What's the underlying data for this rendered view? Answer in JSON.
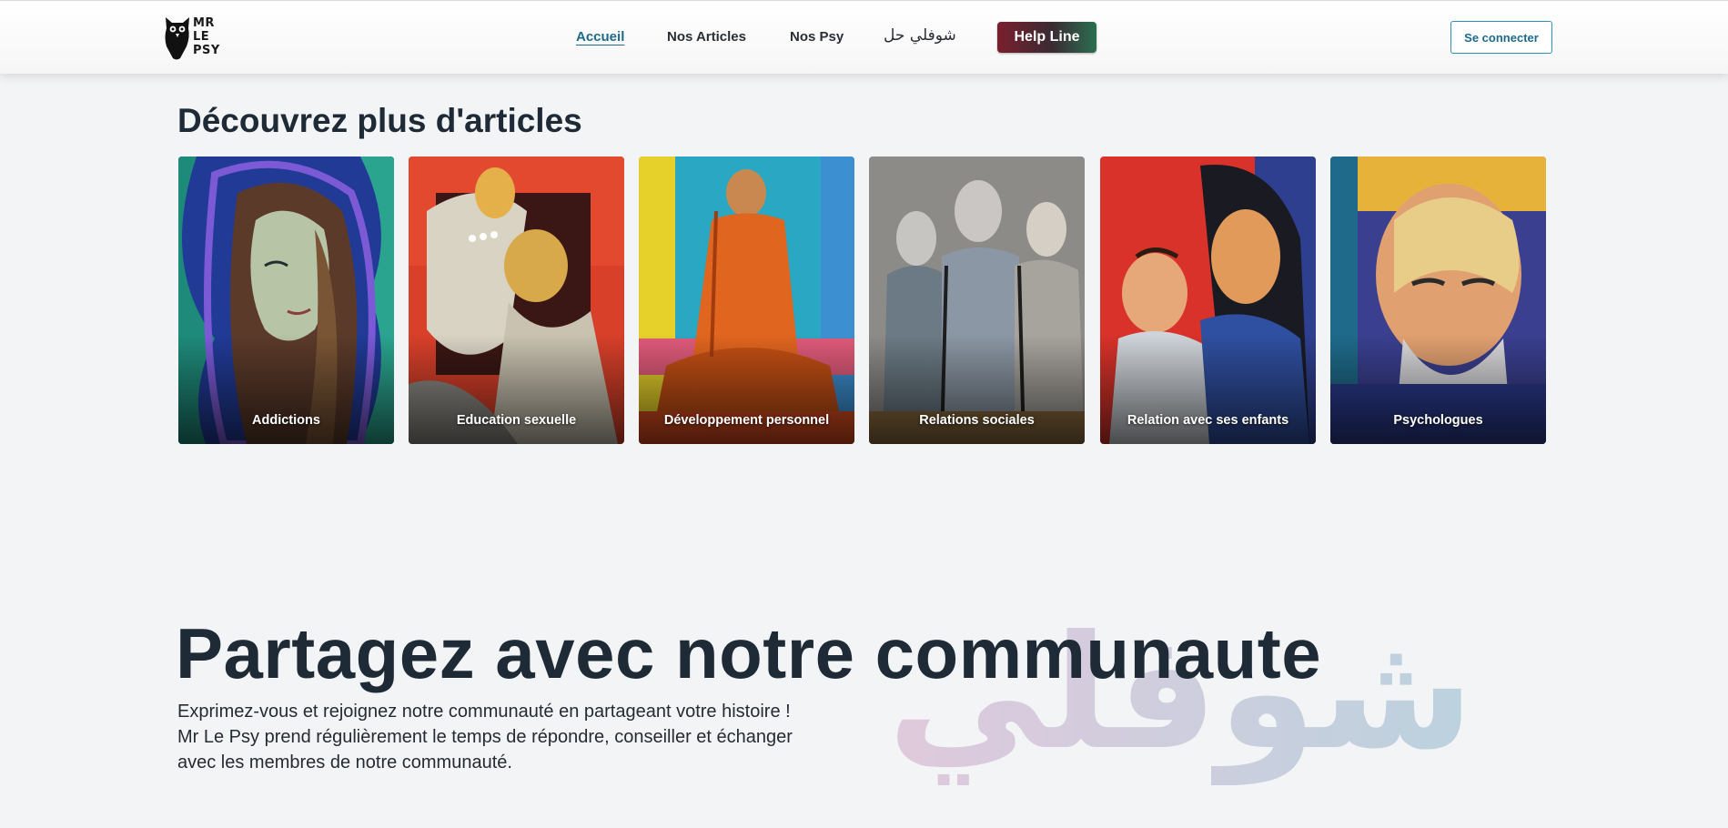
{
  "header": {
    "logo_lines": [
      "MR",
      "LE",
      "PSY"
    ],
    "logo_icon": "owl-icon",
    "nav": [
      {
        "label": "Accueil",
        "active": true
      },
      {
        "label": "Nos Articles",
        "active": false
      },
      {
        "label": "Nos Psy",
        "active": false
      },
      {
        "label": "شوفلي حل",
        "active": false
      }
    ],
    "helpline_label": "Help Line",
    "login_label": "Se connecter"
  },
  "articles": {
    "title": "Découvrez plus d'articles",
    "cards": [
      {
        "label": "Addictions"
      },
      {
        "label": "Education sexuelle"
      },
      {
        "label": "Développement personnel"
      },
      {
        "label": "Relations sociales"
      },
      {
        "label": "Relation avec ses enfants"
      },
      {
        "label": "Psychologues"
      }
    ]
  },
  "community": {
    "title": "Partagez avec notre communaute",
    "description_lines": [
      "Exprimez-vous et rejoignez notre communauté en partageant votre histoire !",
      "Mr Le Psy prend régulièrement le temps de répondre, conseiller et échanger",
      "avec les membres de notre communauté."
    ],
    "watermark": "شوفلي حل"
  },
  "colors": {
    "accent": "#1d6a8c",
    "dark_text": "#1f2a37",
    "background": "#f3f4f6"
  }
}
